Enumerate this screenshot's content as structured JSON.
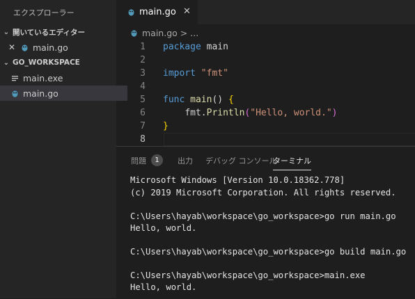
{
  "sidebar": {
    "title": "エクスプローラー",
    "open_editors_label": "開いているエディター",
    "open_editors": [
      {
        "close": "✕",
        "label": "main.go"
      }
    ],
    "workspace_label": "GO_WORKSPACE",
    "files": [
      {
        "label": "main.exe",
        "icon": "exe-icon"
      },
      {
        "label": "main.go",
        "icon": "go-file-icon"
      }
    ]
  },
  "tab": {
    "label": "main.go",
    "close": "✕"
  },
  "breadcrumb": {
    "file": "main.go",
    "sep": ">",
    "rest": "..."
  },
  "editor": {
    "lines": [
      {
        "n": "1",
        "text": "package main"
      },
      {
        "n": "2",
        "text": ""
      },
      {
        "n": "3",
        "text": "import \"fmt\""
      },
      {
        "n": "4",
        "text": ""
      },
      {
        "n": "5",
        "text": "func main() {"
      },
      {
        "n": "6",
        "text": "    fmt.Println(\"Hello, world.\")"
      },
      {
        "n": "7",
        "text": "}"
      },
      {
        "n": "8",
        "text": ""
      }
    ],
    "tokens": {
      "package": "package",
      "main": " main",
      "import": "import",
      "fmt_str": " \"fmt\"",
      "func": "func",
      "main_fn": " main",
      "paren_brace": "() ",
      "lbrace": "{",
      "indent": "    ",
      "fmt_println": "fmt.",
      "println": "Println",
      "lparen": "(",
      "hello": "\"Hello, world.\"",
      "rparen": ")",
      "rbrace": "}"
    }
  },
  "panel": {
    "tabs": [
      "問題",
      "出力",
      "デバッグ コンソール",
      "ターミナル"
    ],
    "problems_count": "1"
  },
  "terminal": {
    "lines": [
      "Microsoft Windows [Version 10.0.18362.778]",
      "(c) 2019 Microsoft Corporation. All rights reserved.",
      "",
      "C:\\Users\\hayab\\workspace\\go_workspace>go run main.go",
      "Hello, world.",
      "",
      "C:\\Users\\hayab\\workspace\\go_workspace>go build main.go",
      "",
      "C:\\Users\\hayab\\workspace\\go_workspace>main.exe",
      "Hello, world."
    ]
  },
  "colors": {
    "go_icon": "#519aba",
    "keyword": "#569cd6",
    "string": "#ce9178",
    "function": "#dcdcaa",
    "bracket": "#ffd700"
  }
}
